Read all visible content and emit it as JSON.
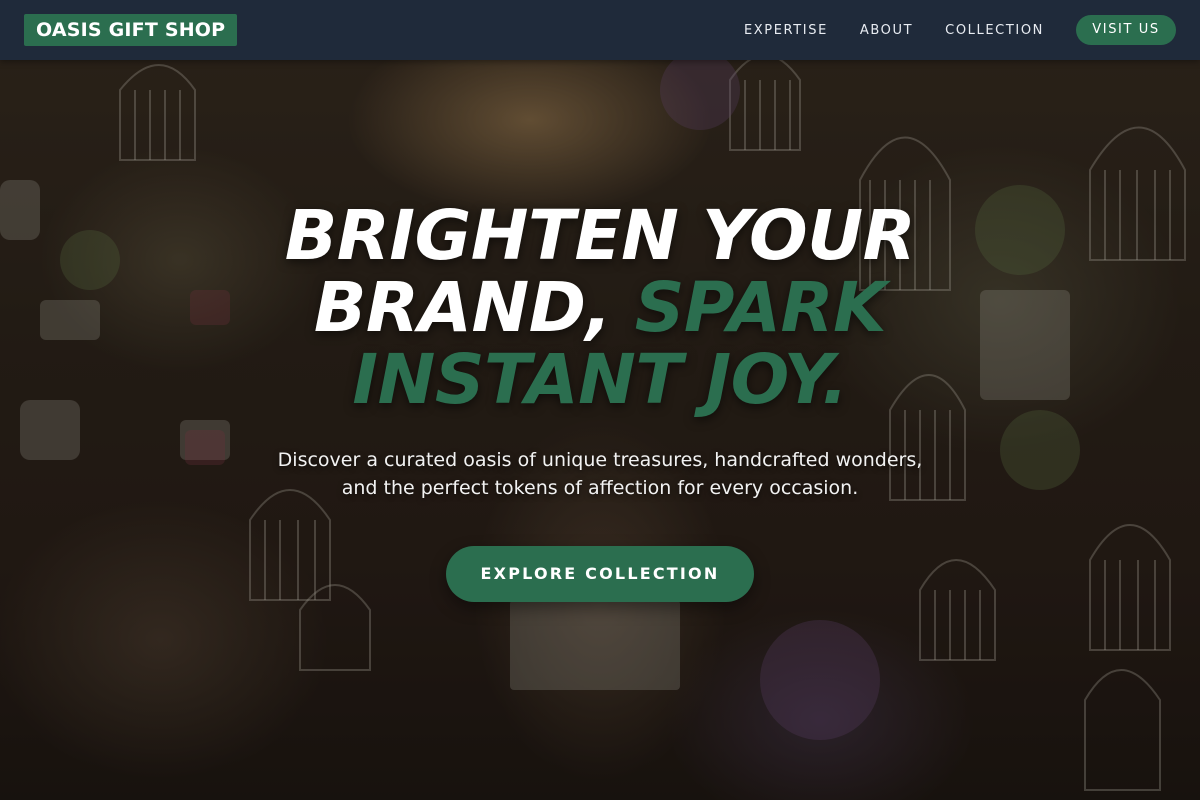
{
  "brand": {
    "name": "OASIS GIFT SHOP",
    "accent_color": "#2b6e4f",
    "nav_bg_color": "#1f2a3a"
  },
  "nav": {
    "links": [
      "EXPERTISE",
      "ABOUT",
      "COLLECTION"
    ],
    "cta_label": "VISIT US"
  },
  "hero": {
    "headline_part1": "BRIGHTEN YOUR BRAND,",
    "headline_accent": "SPARK INSTANT JOY.",
    "subtitle": "Discover a curated oasis of unique treasures, handcrafted wonders, and the perfect tokens of affection for every occasion.",
    "cta_label": "EXPLORE COLLECTION",
    "background_image": "gift-shop-interior-photo"
  }
}
